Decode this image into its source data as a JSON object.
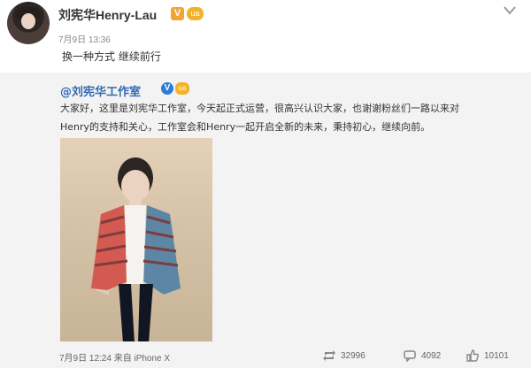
{
  "post": {
    "author": "刘宪华Henry-Lau",
    "time": "7月9日 13:36",
    "text": "换一种方式 继续前行",
    "verify_badge": "V",
    "vip_badge": "ua"
  },
  "repost": {
    "author": "@刘宪华工作室",
    "verify_badge": "V",
    "vip_badge": "ua",
    "body_line1": "大家好，这里是刘宪华工作室，今天起正式运营，很高兴认识大家，也谢谢粉丝们一路以来对",
    "body_line2": "Henry的支持和关心，工作室会和Henry一起开启全新的未来，秉持初心，继续向前。",
    "time_source": "7月9日 12:24 来自 iPhone X",
    "reposts": "32996",
    "comments": "4092",
    "likes": "10101"
  },
  "icons": {
    "dropdown": "chevron-down-icon",
    "repost": "repost-icon",
    "comment": "comment-icon",
    "like": "like-icon"
  }
}
